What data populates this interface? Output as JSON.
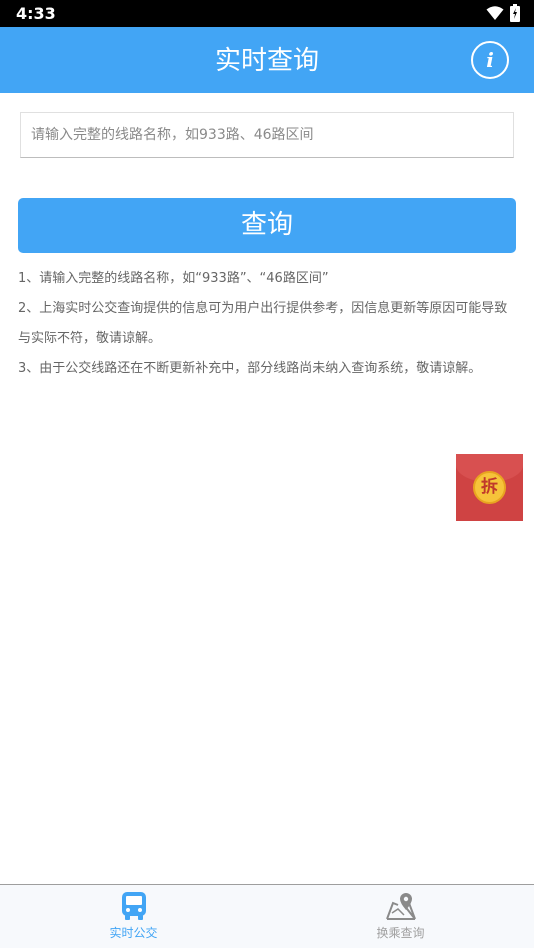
{
  "status_bar": {
    "time": "4:33"
  },
  "app_bar": {
    "title": "实时查询",
    "info_icon_text": "i"
  },
  "search": {
    "placeholder": "请输入完整的线路名称，如933路、46路区间",
    "value": ""
  },
  "query_button": {
    "label": "查询"
  },
  "notes": [
    "1、请输入完整的线路名称，如“933路”、“46路区间”",
    "2、上海实时公交查询提供的信息可为用户出行提供参考，因信息更新等原因可能导致与实际不符，敬请谅解。",
    "3、由于公交线路还在不断更新补充中，部分线路尚未纳入查询系统，敬请谅解。"
  ],
  "red_packet": {
    "label": "拆"
  },
  "tabs": [
    {
      "label": "实时公交",
      "icon": "bus-icon",
      "active": true
    },
    {
      "label": "换乘查询",
      "icon": "map-pin-icon",
      "active": false
    }
  ],
  "colors": {
    "primary": "#42a5f5",
    "red_packet": "#cf4343",
    "coin": "#f6c33a"
  }
}
